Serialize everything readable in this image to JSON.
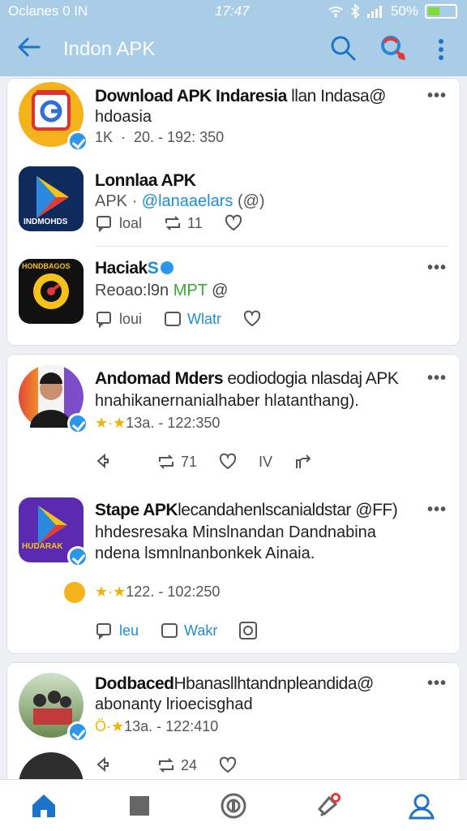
{
  "status": {
    "carrier": "Oclanes  0  IN",
    "time": "17:47",
    "battery": "50%"
  },
  "header": {
    "title": "Indon APK"
  },
  "colors": {
    "accent": "#1d73c8",
    "header_bg": "#a9cde6",
    "verified": "#2e96e8"
  },
  "posts": [
    {
      "name": "Download APK Indaresia",
      "name_tail": "llan Indasa@",
      "sub": "hdoasia",
      "meta": "1K  ·  20. - 192: 350",
      "avatar_icon": "google-play-badge-icon"
    },
    {
      "name": "Lonnlaa APK",
      "handle_prefix": "APK · ",
      "handle": "@lanaaelars",
      "handle_suffix": "(@)",
      "comments": "loal",
      "reposts": "11",
      "avatar_icon": "play-store-icon",
      "avatar_label": "INDMOHDS"
    },
    {
      "name": "Haciak",
      "name_badge": "S",
      "sub_prefix": "Reoao:l9n ",
      "sub_highlight": "MPT",
      "sub_suffix": " @",
      "comments": "loui",
      "bookmark": "Wlatr",
      "avatar_icon": "ring-logo-icon",
      "avatar_label": "HONDBAGOS"
    },
    {
      "name": "Andomad Mders",
      "name_tail": "eodiodogia nlasdaj APK",
      "sub": "hnahikanernanialhaber hlatanthang).",
      "stars": "★·★",
      "meta": "13a. - 122:350",
      "reposts": "71",
      "likes_label": "IV",
      "avatar_icon": "person-avatar-icon"
    },
    {
      "name": "Stape APK",
      "name_tail": "lecandahenlscanialdstar @FF)",
      "sub": "hhdesresaka Minslnandan Dandnabina",
      "sub2": "ndena lsmnlnanbonkek Ainaia.",
      "stars": "★·★",
      "meta": "122. - 102:250",
      "comments": "leu",
      "bookmark": "Wakr",
      "avatar_icon": "play-store-icon",
      "avatar_label": "HUDARAK"
    },
    {
      "name": "Dodbaced",
      "name_tail": "Hbanasllhtandnpleandida@",
      "sub": "abonanty lrioecisghad",
      "stars": "Ö·★",
      "meta": "13a. - 122:410",
      "reposts": "24",
      "avatar_icon": "group-photo-icon"
    }
  ],
  "nav": [
    {
      "icon": "home-icon"
    },
    {
      "icon": "square-icon"
    },
    {
      "icon": "circle-icon"
    },
    {
      "icon": "notification-icon"
    },
    {
      "icon": "profile-icon"
    }
  ]
}
